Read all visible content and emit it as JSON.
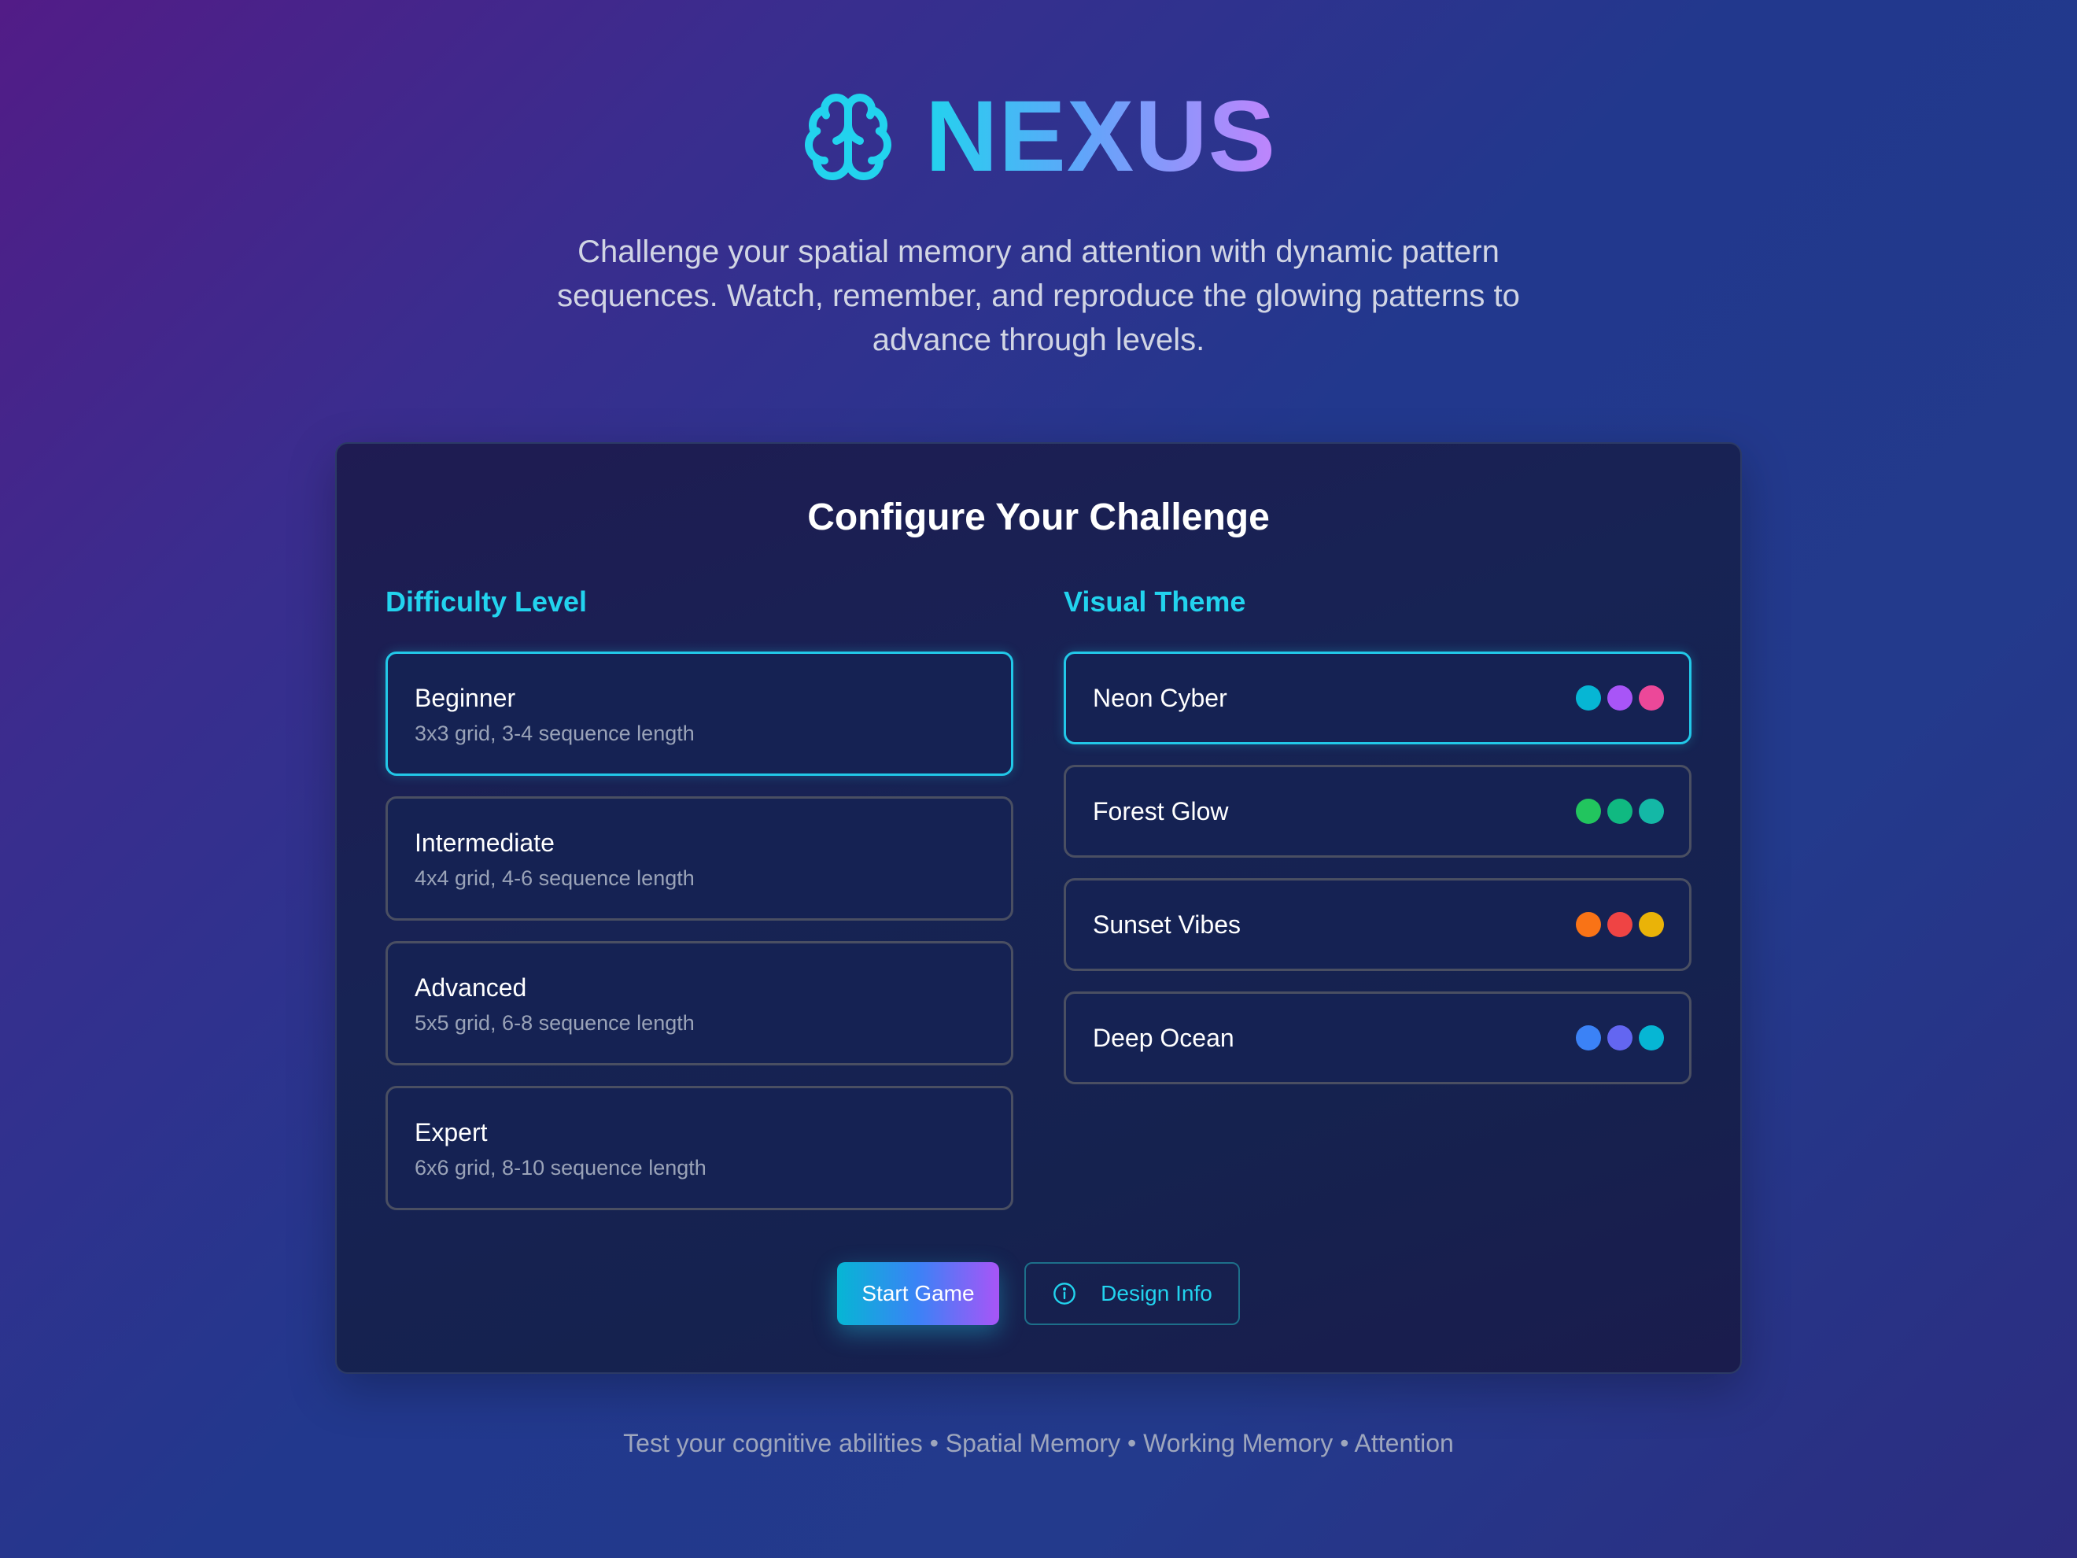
{
  "app": {
    "title": "NEXUS",
    "logo_icon": "brain-icon",
    "tagline": "Challenge your spatial memory and attention with dynamic pattern sequences. Watch, remember, and reproduce the glowing patterns to advance through levels.",
    "accent_color": "#22d3ee"
  },
  "config": {
    "title": "Configure Your Challenge",
    "difficulty": {
      "heading": "Difficulty Level",
      "selected": "Beginner",
      "options": [
        {
          "label": "Beginner",
          "desc": "3x3 grid, 3-4 sequence length"
        },
        {
          "label": "Intermediate",
          "desc": "4x4 grid, 4-6 sequence length"
        },
        {
          "label": "Advanced",
          "desc": "5x5 grid, 6-8 sequence length"
        },
        {
          "label": "Expert",
          "desc": "6x6 grid, 8-10 sequence length"
        }
      ]
    },
    "theme": {
      "heading": "Visual Theme",
      "selected": "Neon Cyber",
      "options": [
        {
          "label": "Neon Cyber",
          "colors": [
            "#06b6d4",
            "#a855f7",
            "#ec4899"
          ]
        },
        {
          "label": "Forest Glow",
          "colors": [
            "#22c55e",
            "#10b981",
            "#14b8a6"
          ]
        },
        {
          "label": "Sunset Vibes",
          "colors": [
            "#f97316",
            "#ef4444",
            "#eab308"
          ]
        },
        {
          "label": "Deep Ocean",
          "colors": [
            "#3b82f6",
            "#6366f1",
            "#06b6d4"
          ]
        }
      ]
    }
  },
  "actions": {
    "start_label": "Start Game",
    "info_label": "Design Info",
    "info_icon": "info-circle-icon"
  },
  "footer": {
    "text": "Test your cognitive abilities • Spatial Memory • Working Memory • Attention"
  }
}
